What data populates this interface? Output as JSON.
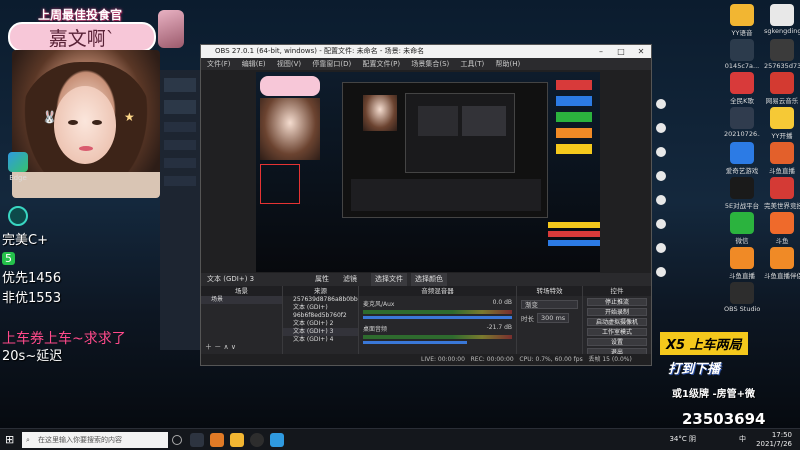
{
  "overlay": {
    "banner_title": "上周最佳投食官",
    "banner_name": "嘉文啊`",
    "line1": "完美C+",
    "line2_badge": "5",
    "line3": "优先1456",
    "line4": "非优1553",
    "pink_line": "上车券上车~求求了",
    "line5": "20s~延迟",
    "x5_text": "X5  上车两局",
    "daka_text": "打到下播",
    "rank_text": "或1级牌 -房管+微",
    "qq_number": "23503694"
  },
  "desktop_left": {
    "edge_label": "Edge"
  },
  "obs": {
    "title": "OBS 27.0.1 (64-bit, windows) - 配置文件: 未命名 - 场景: 未命名",
    "menu": [
      "文件(F)",
      "编辑(E)",
      "视图(V)",
      "停靠窗口(D)",
      "配置文件(P)",
      "场景集合(S)",
      "工具(T)",
      "帮助(H)"
    ],
    "ctrl_bar": {
      "source_label": "文本 (GDI+) 3",
      "props": "属性",
      "filters": "滤镜",
      "select_file": "选择文件",
      "select_color": "选择颜色"
    },
    "scenes_header": "场景",
    "scenes": [
      "场景"
    ],
    "sources_header": "来源",
    "sources": [
      "257639d8786a8b0bb",
      "文本 (GDI+)",
      "96b6f8ed5b760f2",
      "文本 (GDI+) 2",
      "文本 (GDI+) 3",
      "文本 (GDI+) 4"
    ],
    "mixer_header": "音频混音器",
    "mixer": [
      {
        "name": "麦克风/Aux",
        "db": "0.0 dB"
      },
      {
        "name": "桌面音频",
        "db": "-21.7 dB"
      }
    ],
    "transitions_header": "转场特效",
    "transition_name": "渐变",
    "duration_label": "时长",
    "duration_value": "300 ms",
    "controls_header": "控件",
    "controls": [
      "停止推流",
      "开始录制",
      "启动虚拟摄像机",
      "工作室模式",
      "设置",
      "退出"
    ],
    "status": {
      "live": "LIVE: 00:00:00",
      "rec": "REC: 00:00:00",
      "cpu": "CPU: 0.7%, 60.00 fps",
      "dropped": "丢帧 15 (0.0%)"
    }
  },
  "desktop_right": [
    {
      "label": "YY语音",
      "color": "#f2b632"
    },
    {
      "label": "sgkengding",
      "color": "#e8e8e8"
    },
    {
      "label": "0145c7a...",
      "color": "#2c3b4c"
    },
    {
      "label": "257635d73...",
      "color": "#3b3b3b"
    },
    {
      "label": "全民K歌",
      "color": "#d83a3a"
    },
    {
      "label": "网易云音乐",
      "color": "#d33a31"
    },
    {
      "label": "20210726...",
      "color": "#303c4e"
    },
    {
      "label": "YY开播",
      "color": "#f6c936"
    },
    {
      "label": "爱奇艺游戏",
      "color": "#2c7be5"
    },
    {
      "label": "斗鱼直播",
      "color": "#e3602b"
    },
    {
      "label": "5E对战平台",
      "color": "#1a1a1a"
    },
    {
      "label": "完美世界竞技平台",
      "color": "#d43a35"
    },
    {
      "label": "微信",
      "color": "#2bb33e"
    },
    {
      "label": "斗鱼",
      "color": "#ef6a2b"
    },
    {
      "label": "斗鱼直播",
      "color": "#f08a26"
    },
    {
      "label": "斗鱼直播伴侣",
      "color": "#f08a26"
    },
    {
      "label": "OBS Studio",
      "color": "#2d2d2d"
    }
  ],
  "taskbar": {
    "search_placeholder": "在这里输入你要搜索的内容",
    "temp": "34°C 阴",
    "lang": "中",
    "time": "17:50",
    "date": "2021/7/26"
  }
}
